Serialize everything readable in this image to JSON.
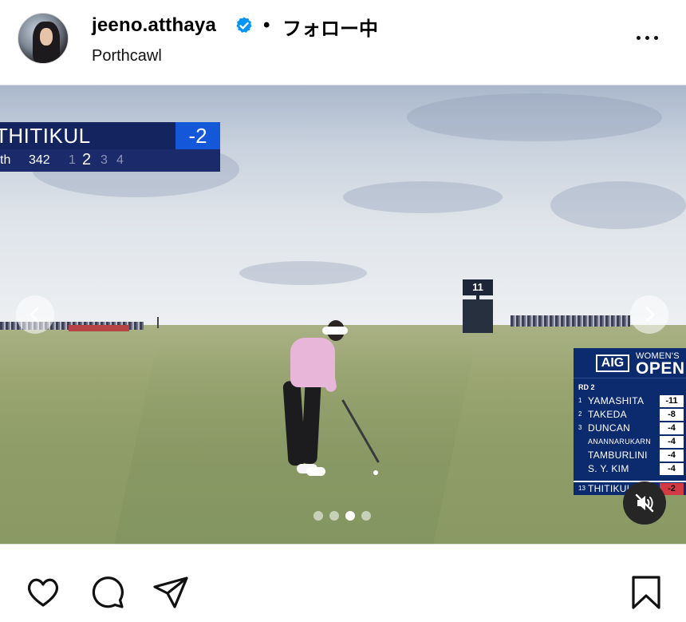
{
  "header": {
    "username": "jeeno.atthaya",
    "separator": "•",
    "follow_status": "フォロー中",
    "location": "Porthcawl",
    "verified_icon": "verified-badge-icon",
    "verified_color": "#0095f6",
    "more_icon": "more-options-icon"
  },
  "video": {
    "banner": {
      "player": "THITIKUL",
      "score": "-2",
      "hole_info": "th",
      "yards": "342",
      "shots": [
        "1",
        "2",
        "3",
        "4"
      ],
      "current_shot": "2"
    },
    "tower_number": "11",
    "leaderboard": {
      "brand": "AIG",
      "title_line1": "WOMEN'S",
      "title_line2": "OPEN",
      "round": "RD 2",
      "rows": [
        {
          "pos": "1",
          "name": "YAMASHITA",
          "score": "-11"
        },
        {
          "pos": "2",
          "name": "TAKEDA",
          "score": "-8"
        },
        {
          "pos": "3",
          "name": "DUNCAN",
          "score": "-4"
        },
        {
          "pos": "",
          "name": "ANANNARUKARN",
          "score": "-4"
        },
        {
          "pos": "",
          "name": "TAMBURLINI",
          "score": "-4"
        },
        {
          "pos": "",
          "name": "S. Y. KIM",
          "score": "-4"
        }
      ],
      "highlight": {
        "pos": "13",
        "name": "THITIKUL",
        "score": "-2"
      },
      "highlight_color": "#d23b43"
    }
  },
  "carousel": {
    "slide_count": 4,
    "active_index": 2,
    "prev_icon": "chevron-left-icon",
    "next_icon": "chevron-right-icon",
    "mute_icon": "muted-speaker-icon"
  },
  "actions": {
    "like_icon": "heart-icon",
    "comment_icon": "comment-icon",
    "share_icon": "send-icon",
    "save_icon": "bookmark-icon"
  }
}
